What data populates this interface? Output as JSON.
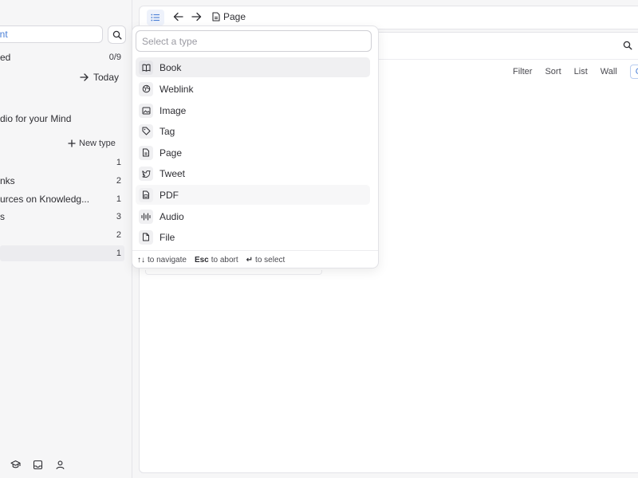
{
  "sidebar": {
    "search_text": "ent",
    "rows": [
      {
        "label": "ed",
        "count": "0/9"
      },
      {
        "label": "dio for your Mind",
        "count": ""
      },
      {
        "label": "",
        "count": "1"
      },
      {
        "label": "nks",
        "count": "2"
      },
      {
        "label": "urces on Knowledg...",
        "count": "1"
      },
      {
        "label": "s",
        "count": "3"
      },
      {
        "label": "",
        "count": "2"
      },
      {
        "label": "",
        "count": "1"
      }
    ],
    "today_label": "Today",
    "new_type_label": "New type"
  },
  "topbar": {
    "page_label": "Page"
  },
  "main": {
    "views": [
      "Filter",
      "Sort",
      "List",
      "Wall",
      "Gal"
    ]
  },
  "type_picker": {
    "placeholder": "Select a type",
    "items": [
      {
        "label": "Book",
        "icon": "book-icon"
      },
      {
        "label": "Weblink",
        "icon": "weblink-icon"
      },
      {
        "label": "Image",
        "icon": "image-icon"
      },
      {
        "label": "Tag",
        "icon": "tag-icon"
      },
      {
        "label": "Page",
        "icon": "page-icon"
      },
      {
        "label": "Tweet",
        "icon": "tweet-icon"
      },
      {
        "label": "PDF",
        "icon": "pdf-icon"
      },
      {
        "label": "Audio",
        "icon": "audio-icon"
      },
      {
        "label": "File",
        "icon": "file-icon"
      }
    ],
    "footer": {
      "navigate_keys": "↑↓",
      "navigate_label": "to navigate",
      "abort_key": "Esc",
      "abort_label": "to abort",
      "select_key": "↵",
      "select_label": "to select"
    }
  },
  "colors": {
    "accent": "#4a7fd6",
    "active_item_bg": "#f0f0f2",
    "border": "#e4e4e8"
  }
}
